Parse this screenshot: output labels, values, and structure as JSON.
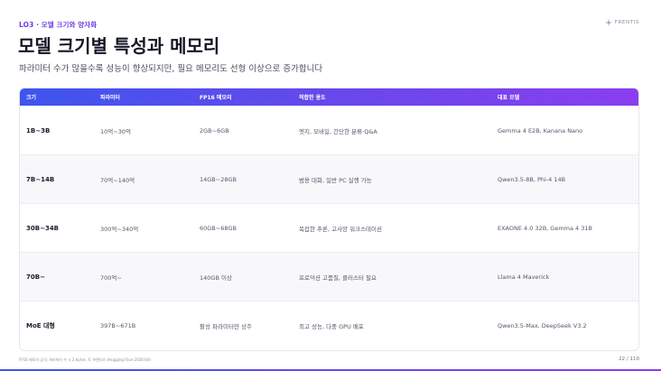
{
  "header": {
    "eyebrow": "LO3 · 모델 크기와 양자화",
    "brand": "FRENTIS",
    "title": "모델 크기별 특성과 메모리",
    "subtitle": "파라미터 수가 많을수록 성능이 향상되지만, 필요 메모리도 선형 이상으로 증가합니다"
  },
  "table": {
    "headers": [
      "크기",
      "파라미터",
      "FP16 메모리",
      "적합한 용도",
      "대표 모델"
    ],
    "rows": [
      {
        "size": "1B~3B",
        "params": "10억~30억",
        "memory": "2GB~6GB",
        "use": "엣지, 모바일, 간단한 분류·Q&A",
        "models": "Gemma 4 E2B, Kanana Nano"
      },
      {
        "size": "7B~14B",
        "params": "70억~140억",
        "memory": "14GB~28GB",
        "use": "범용 대화, 일반 PC 실행 가능",
        "models": "Qwen3.5-8B, Phi-4 14B"
      },
      {
        "size": "30B~34B",
        "params": "300억~340억",
        "memory": "60GB~68GB",
        "use": "복잡한 추론, 고사양 워크스테이션",
        "models": "EXAONE 4.0 32B, Gemma 4 31B"
      },
      {
        "size": "70B~",
        "params": "700억~",
        "memory": "140GB 이상",
        "use": "프로덕션 고품질, 클러스터 필요",
        "models": "Llama 4 Maverick"
      },
      {
        "size": "MoE 대형",
        "params": "397B~671B",
        "memory": "활성 파라미터만 상주",
        "use": "최고 성능, 다중 GPU 배포",
        "models": "Qwen3.5-Max, DeepSeek V3.2"
      }
    ]
  },
  "footer": {
    "note": "FP16 메모리 공식: 파라미터 수 × 2 bytes. © 프렌티스 (Hugging Face 2026-04)",
    "page": "22 / 110"
  },
  "colors": {
    "accent": "#6a3fe0",
    "header_gradient_start": "#3e55ee",
    "header_gradient_end": "#8a3ef0"
  }
}
